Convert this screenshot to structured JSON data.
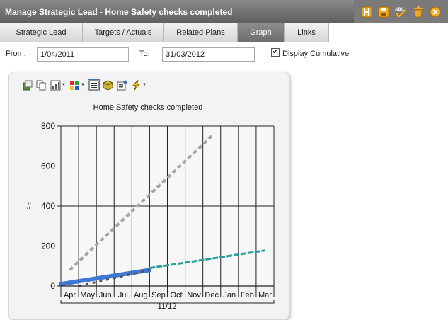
{
  "window": {
    "title": "Manage Strategic Lead - Home Safety checks completed",
    "icons": [
      "hierarchy-icon",
      "save-icon",
      "spell-check-icon",
      "delete-icon",
      "close-icon"
    ]
  },
  "tabs": [
    {
      "label": "Strategic Lead",
      "active": false
    },
    {
      "label": "Targets / Actuals",
      "active": false
    },
    {
      "label": "Related Plans",
      "active": false
    },
    {
      "label": "Graph",
      "active": true
    },
    {
      "label": "Links",
      "active": false
    }
  ],
  "filter": {
    "from_label": "From:",
    "from_value": "1/04/2011",
    "to_label": "To:",
    "to_value": "31/03/2012",
    "cumulative_label": "Display Cumulative",
    "cumulative_checked": true
  },
  "chart_toolbar": {
    "icons": [
      "export-icon",
      "copy-icon",
      "chart-type-icon",
      "palette-icon",
      "legend-icon",
      "3d-icon",
      "properties-icon",
      "tools-icon"
    ]
  },
  "colors": {
    "target": "#a6a6a6",
    "actual_blue": "#3e78d6",
    "actual_dark": "#555555",
    "projection": "#2f9e9a"
  },
  "chart_data": {
    "type": "line",
    "title": "Home Safety checks completed",
    "ylabel": "#",
    "xlabel": "11/12",
    "categories": [
      "Apr",
      "May",
      "Jun",
      "Jul",
      "Aug",
      "Sep",
      "Oct",
      "Nov",
      "Dec",
      "Jan",
      "Feb",
      "Mar"
    ],
    "ylim": [
      0,
      800
    ],
    "yticks": [
      0,
      200,
      400,
      600,
      800
    ],
    "grid": true,
    "legend": "none",
    "series": [
      {
        "style": "dashed-gray",
        "x": [
          0.5,
          8.5
        ],
        "y": [
          80,
          750
        ]
      },
      {
        "style": "solid-blue",
        "x": [
          0,
          5
        ],
        "y": [
          10,
          80
        ]
      },
      {
        "style": "dotted-dark",
        "x": [
          1,
          5
        ],
        "y": [
          0,
          80
        ]
      },
      {
        "style": "dashed-teal",
        "x": [
          5,
          11.5
        ],
        "y": [
          90,
          178
        ]
      }
    ]
  }
}
